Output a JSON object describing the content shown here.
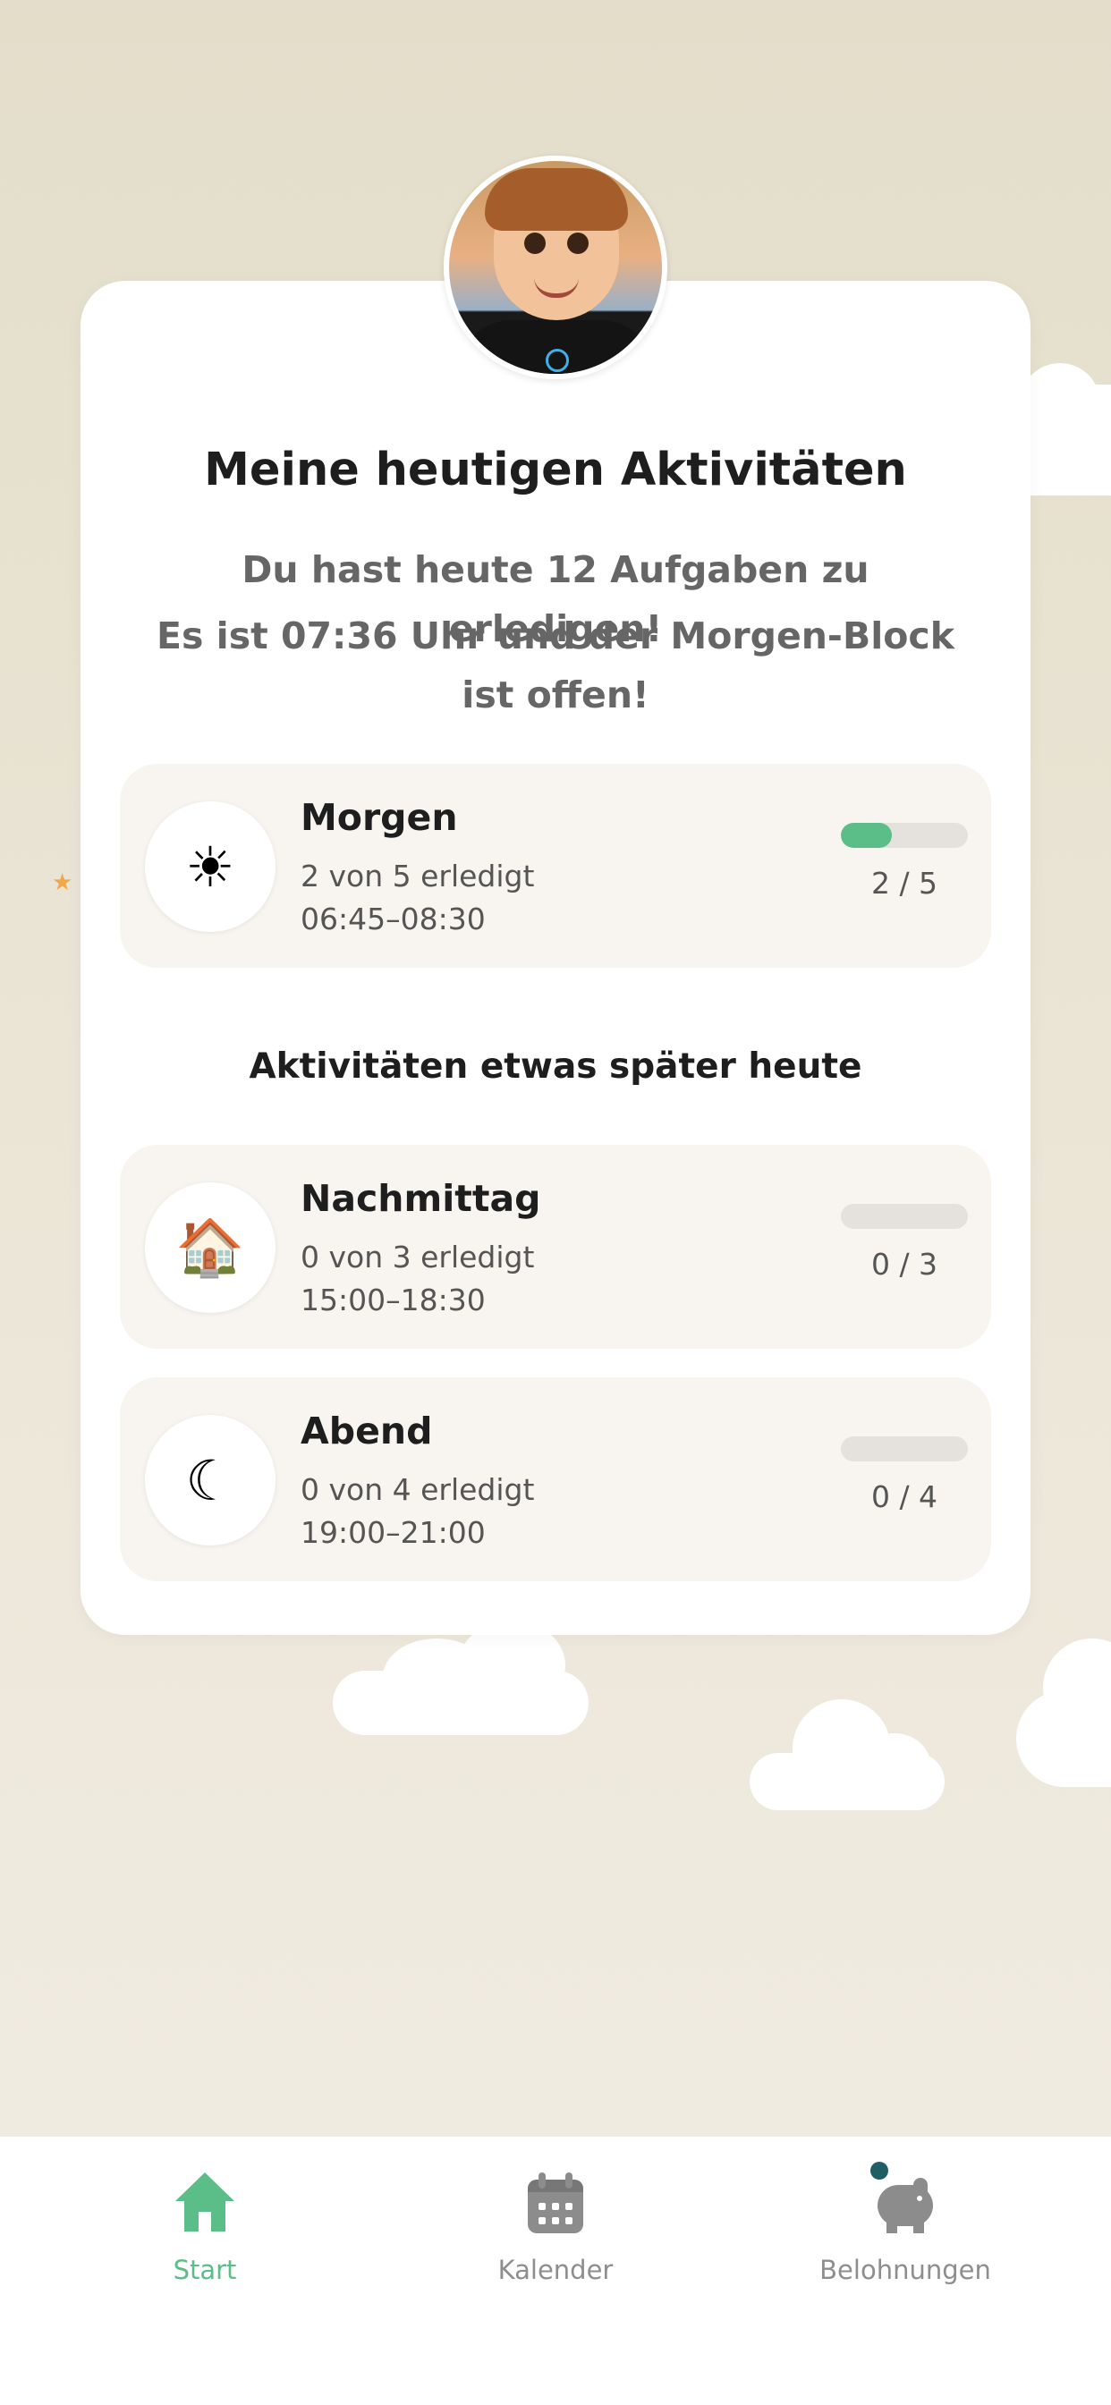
{
  "header": {
    "title": "Meine heutigen Aktivitäten",
    "tasks_today": "Du hast heute 12 Aufgaben zu erledigen!",
    "status_line": "Es ist 07:36 Uhr und der Morgen-Block ist offen!"
  },
  "current_block": {
    "name": "Morgen",
    "icon": "morning-icon",
    "done_text": "2 von 5 erledigt",
    "time": "06:45–08:30",
    "progress_fraction": 0.4,
    "count": "2 / 5"
  },
  "later_heading": "Aktivitäten etwas später heute",
  "later_blocks": [
    {
      "name": "Nachmittag",
      "icon": "afternoon-icon",
      "done_text": "0 von 3 erledigt",
      "time": "15:00–18:30",
      "progress_fraction": 0,
      "count": "0 / 3"
    },
    {
      "name": "Abend",
      "icon": "evening-icon",
      "done_text": "0 von 4 erledigt",
      "time": "19:00–21:00",
      "progress_fraction": 0,
      "count": "0 / 4"
    }
  ],
  "tabs": [
    {
      "label": "Start",
      "icon": "home-icon",
      "active": true
    },
    {
      "label": "Kalender",
      "icon": "calendar-icon",
      "active": false
    },
    {
      "label": "Belohnungen",
      "icon": "piggy-bank-icon",
      "active": false,
      "badge": true
    }
  ],
  "colors": {
    "accent": "#5bbd88",
    "badge": "#1f5f63",
    "background": "#e8e2d3"
  }
}
